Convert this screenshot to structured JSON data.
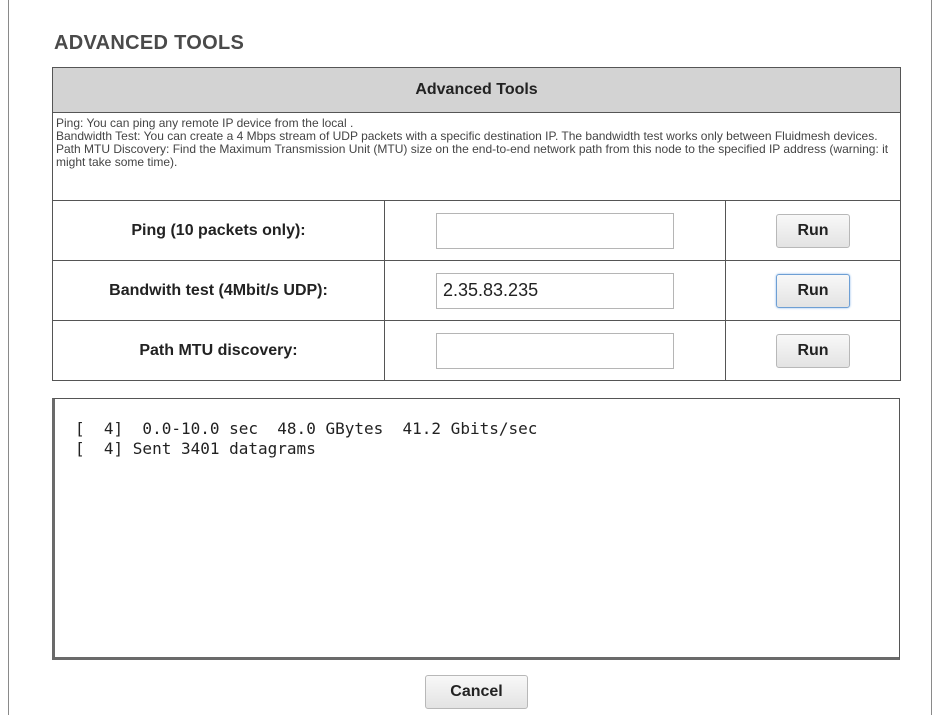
{
  "page": {
    "title": "ADVANCED TOOLS"
  },
  "table": {
    "header": "Advanced Tools",
    "description": [
      "Ping: You can ping any remote IP device from the local .",
      "Bandwidth Test: You can create a 4 Mbps stream of UDP packets with a specific destination IP. The bandwidth test works only between Fluidmesh devices.",
      "Path MTU Discovery: Find the Maximum Transmission Unit (MTU) size on the end-to-end network path from this node to the specified IP address (warning: it might take some time)."
    ],
    "rows": [
      {
        "label": "Ping (10 packets only):",
        "value": "",
        "button": "Run",
        "focused": false
      },
      {
        "label": "Bandwith test (4Mbit/s UDP):",
        "value": "2.35.83.235",
        "button": "Run",
        "focused": true
      },
      {
        "label": "Path MTU discovery:",
        "value": "",
        "button": "Run",
        "focused": false
      }
    ]
  },
  "output": {
    "lines": [
      "[  4]  0.0-10.0 sec  48.0 GBytes  41.2 Gbits/sec",
      "[  4] Sent 3401 datagrams"
    ]
  },
  "footer": {
    "cancel_label": "Cancel"
  }
}
